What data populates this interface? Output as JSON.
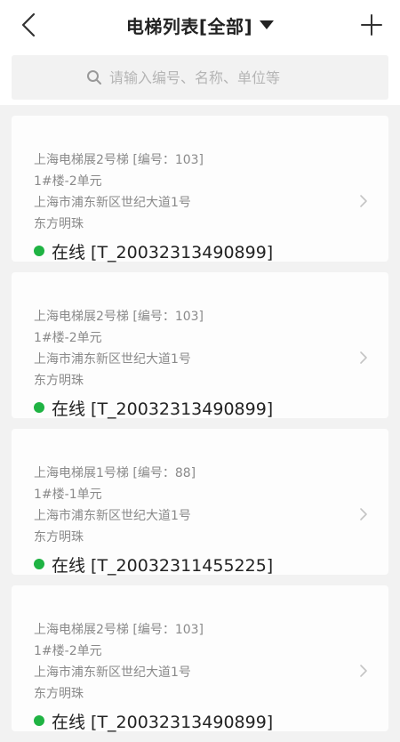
{
  "header": {
    "title": "电梯列表[全部]",
    "back_icon": "chevron-left-icon",
    "add_icon": "plus-icon",
    "caret_icon": "caret-down-icon"
  },
  "search": {
    "placeholder": "请输入编号、名称、单位等",
    "value": "",
    "icon": "search-icon"
  },
  "colors": {
    "online": "#1fb343",
    "chevron": "#c4c4c4"
  },
  "elevators": [
    {
      "name_line": "上海电梯展2号梯 [编号：103]",
      "unit": "1#楼-2单元",
      "address": "上海市浦东新区世纪大道1号",
      "place": "东方明珠",
      "status": "在线 [T_20032313490899]"
    },
    {
      "name_line": "上海电梯展2号梯 [编号：103]",
      "unit": "1#楼-2单元",
      "address": "上海市浦东新区世纪大道1号",
      "place": "东方明珠",
      "status": "在线 [T_20032313490899]"
    },
    {
      "name_line": "上海电梯展1号梯 [编号：88]",
      "unit": "1#楼-1单元",
      "address": "上海市浦东新区世纪大道1号",
      "place": "东方明珠",
      "status": "在线 [T_20032311455225]"
    },
    {
      "name_line": "上海电梯展2号梯 [编号：103]",
      "unit": "1#楼-2单元",
      "address": "上海市浦东新区世纪大道1号",
      "place": "东方明珠",
      "status": "在线 [T_20032313490899]"
    }
  ]
}
